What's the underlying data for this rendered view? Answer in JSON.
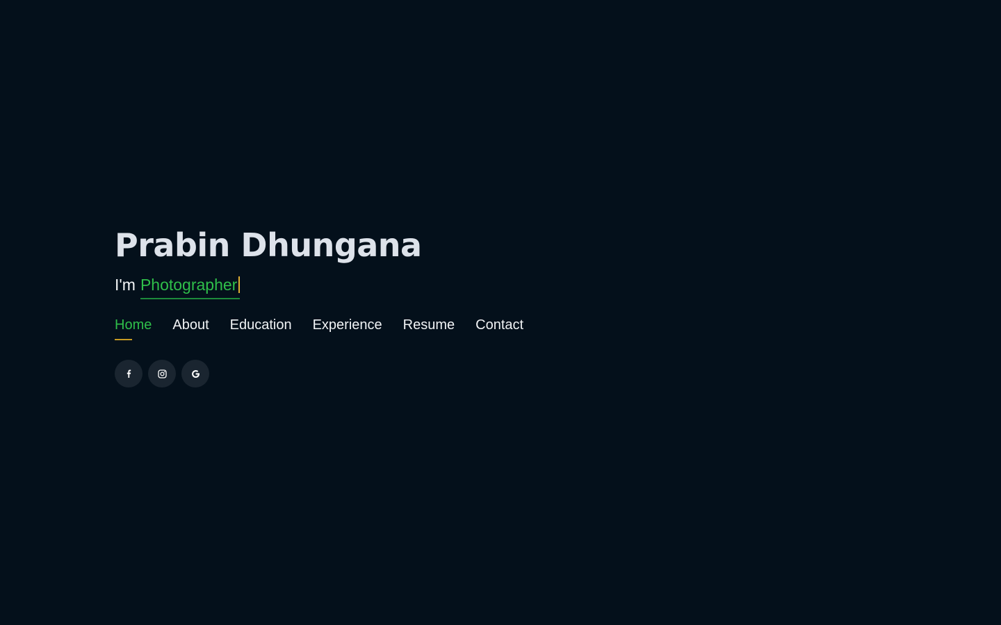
{
  "hero": {
    "name": "Prabin Dhungana",
    "tagline_prefix": "I'm",
    "tagline_typed": "Photographer"
  },
  "nav": {
    "items": [
      {
        "label": "Home",
        "active": true
      },
      {
        "label": "About"
      },
      {
        "label": "Education"
      },
      {
        "label": "Experience"
      },
      {
        "label": "Resume"
      },
      {
        "label": "Contact"
      }
    ]
  },
  "social": {
    "icons": [
      "facebook-icon",
      "instagram-icon",
      "google-icon"
    ]
  },
  "colors": {
    "background": "#04101b",
    "accent_green": "#2fbf4a",
    "accent_gold": "#c79a23",
    "social_button_bg": "#1a2530"
  }
}
